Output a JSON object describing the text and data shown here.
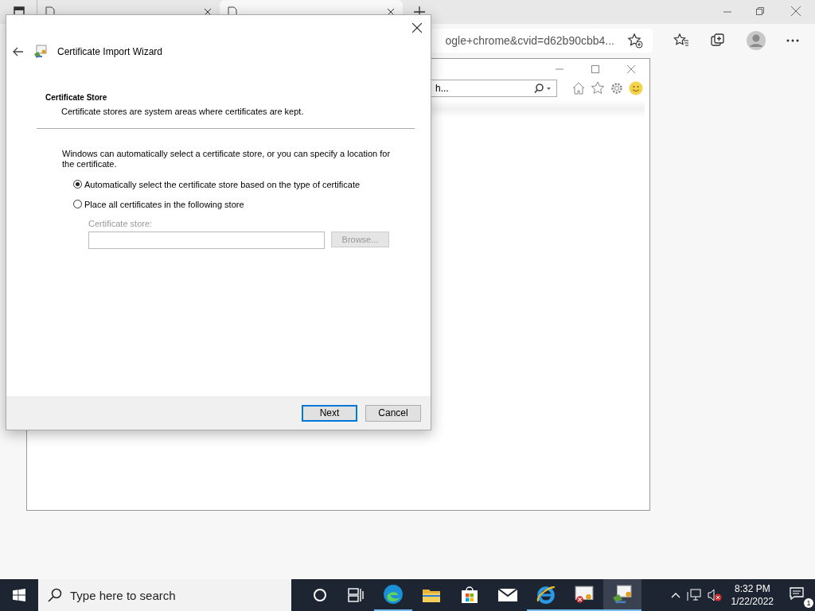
{
  "browser": {
    "tabs": [
      {
        "selected": false
      },
      {
        "selected": true
      }
    ],
    "address": "ogle+chrome&cvid=d62b90cbb4..."
  },
  "ie_window": {
    "search": "h..."
  },
  "dialog": {
    "title": "Certificate Import Wizard",
    "heading": "Certificate Store",
    "subheading": "Certificate stores are system areas where certificates are kept.",
    "intro": "Windows can automatically select a certificate store, or you can specify a location for the certificate.",
    "options": [
      {
        "label": "Automatically select the certificate store based on the type of certificate",
        "selected": true
      },
      {
        "label": "Place all certificates in the following store",
        "selected": false
      }
    ],
    "store_label": "Certificate store:",
    "store_disabled": true,
    "browse": "Browse...",
    "buttons": [
      {
        "label": "Next",
        "kind": "default"
      },
      {
        "label": "Cancel",
        "kind": "normal"
      }
    ]
  },
  "taskbar": {
    "search_placeholder": "Type here to search",
    "time": "8:32 PM",
    "date": "1/22/2022",
    "notifications": "1"
  }
}
